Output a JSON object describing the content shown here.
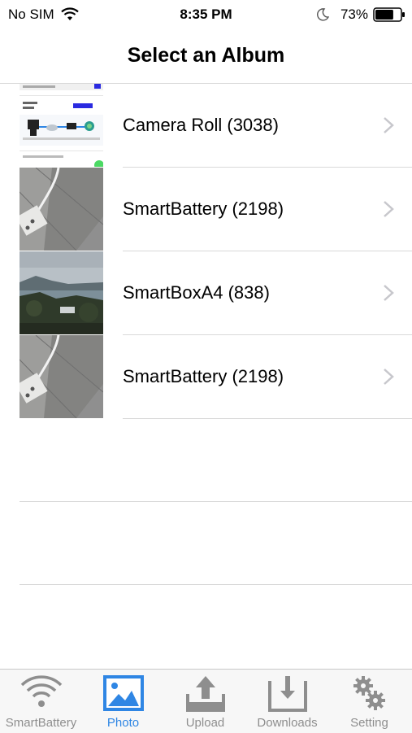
{
  "status_bar": {
    "carrier": "No SIM",
    "time": "8:35 PM",
    "battery_percent": "73%",
    "battery_level": 0.73
  },
  "nav": {
    "title": "Select an Album"
  },
  "albums": [
    {
      "label": "Camera Roll (3038)",
      "thumb": "settings-screenshot"
    },
    {
      "label": "SmartBattery (2198)",
      "thumb": "power-strip-photo"
    },
    {
      "label": "SmartBoxA4 (838)",
      "thumb": "lake-landscape-photo"
    },
    {
      "label": "SmartBattery (2198)",
      "thumb": "power-strip-photo"
    }
  ],
  "tabs": [
    {
      "label": "SmartBattery",
      "icon": "wifi-icon",
      "active": false
    },
    {
      "label": "Photo",
      "icon": "photo-icon",
      "active": true
    },
    {
      "label": "Upload",
      "icon": "upload-icon",
      "active": false
    },
    {
      "label": "Downloads",
      "icon": "download-icon",
      "active": false
    },
    {
      "label": "Setting",
      "icon": "gear-icon",
      "active": false
    }
  ],
  "colors": {
    "accent": "#2f86e4",
    "inactive_tab": "#8e8e8e",
    "separator": "#d9d9d9"
  }
}
